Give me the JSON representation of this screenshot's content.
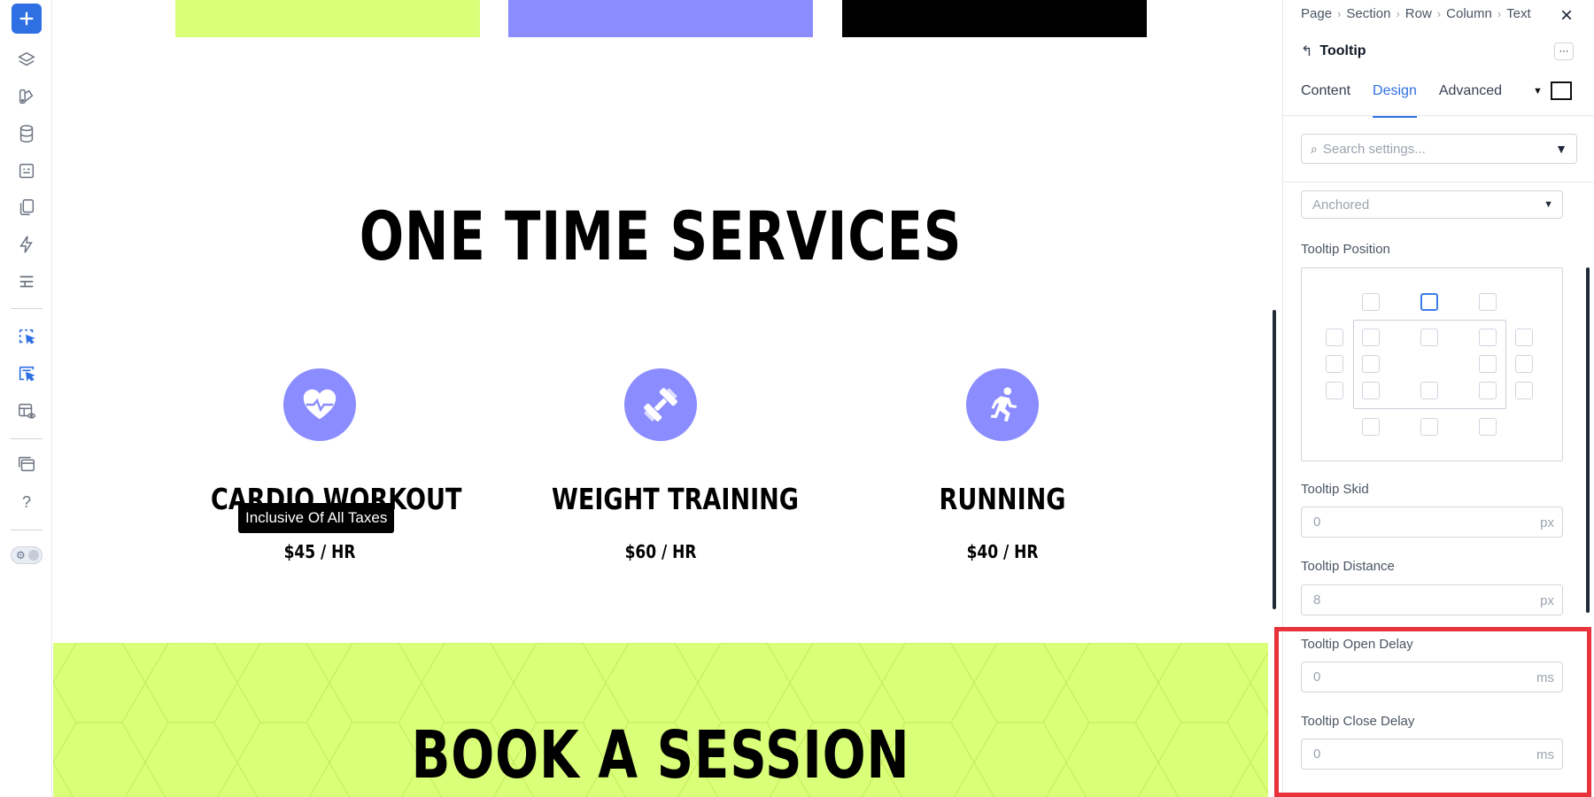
{
  "toolbar": {
    "icons": [
      "plus-icon",
      "layers-icon",
      "style-icon",
      "database-icon",
      "form-icon",
      "pages-icon",
      "bolt-icon",
      "table-icon",
      "pointer-select-icon",
      "pointer-select-all-icon",
      "preview-icon",
      "templates-icon",
      "help-icon",
      "theme-toggle-icon"
    ],
    "help_glyph": "?",
    "accent": "#2f6fe4"
  },
  "canvas": {
    "swatches": [
      "#daff79",
      "#8b8cff",
      "#000000"
    ],
    "section_title": "ONE TIME SERVICES",
    "services": [
      {
        "name": "CARDIO WORKOUT",
        "price": "$45 / HR",
        "icon": "heart-icon"
      },
      {
        "name": "WEIGHT TRAINING",
        "price": "$60 / HR",
        "icon": "dumbbell-icon"
      },
      {
        "name": "RUNNING",
        "price": "$40 / HR",
        "icon": "running-icon"
      }
    ],
    "tooltip_text": "Inclusive Of All Taxes",
    "book_title": "BOOK A SESSION",
    "icon_circle_color": "#8b8cff",
    "book_bg_color": "#daff79"
  },
  "panel": {
    "breadcrumbs": [
      "Page",
      "Section",
      "Row",
      "Column",
      "Text"
    ],
    "title": "Tooltip",
    "tabs": [
      {
        "label": "Content",
        "active": false
      },
      {
        "label": "Design",
        "active": true
      },
      {
        "label": "Advanced",
        "active": false
      }
    ],
    "search_placeholder": "Search settings...",
    "anchor_select": "Anchored",
    "position_label": "Tooltip Position",
    "skid_label": "Tooltip Skid",
    "skid_value": "0",
    "skid_unit": "px",
    "distance_label": "Tooltip Distance",
    "distance_value": "8",
    "distance_unit": "px",
    "open_delay_label": "Tooltip Open Delay",
    "open_delay_value": "0",
    "open_delay_unit": "ms",
    "close_delay_label": "Tooltip Close Delay",
    "close_delay_value": "0",
    "close_delay_unit": "ms",
    "highlight_color": "#e8323c"
  }
}
